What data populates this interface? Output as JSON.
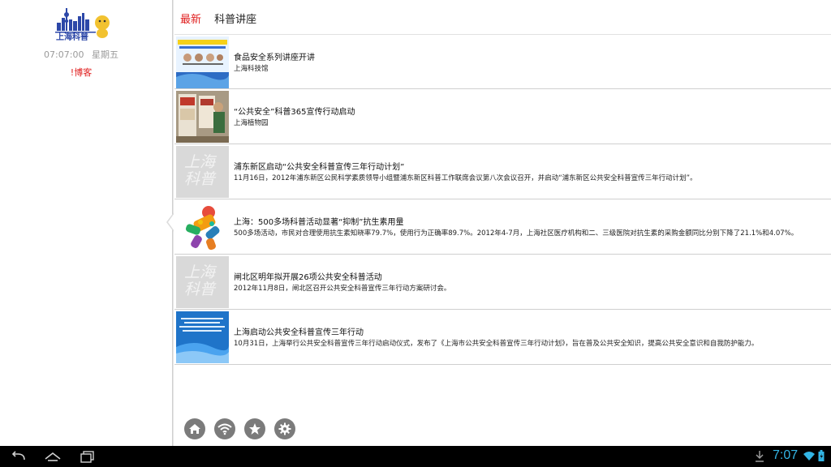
{
  "app": {
    "logo_text": "上海科普"
  },
  "sidebar": {
    "time": "07:07:00",
    "weekday": "星期五",
    "blog_link": "!博客"
  },
  "tabs": [
    {
      "label": "最新",
      "active": true
    },
    {
      "label": "科普讲座",
      "active": false
    }
  ],
  "articles": [
    {
      "title": "食品安全系列讲座开讲",
      "subtitle": "上海科技馆",
      "thumb": "lecture-banner"
    },
    {
      "title": "“公共安全”科普365宣传行动启动",
      "subtitle": "上海植物园",
      "thumb": "exhibition-photo"
    },
    {
      "title": "浦东新区启动“公共安全科普宣传三年行动计划”",
      "subtitle": "11月16日，2012年浦东新区公民科学素质领导小组暨浦东新区科普工作联席会议第八次会议召开，并启动“浦东新区公共安全科普宣传三年行动计划”。",
      "thumb": "placeholder"
    },
    {
      "title": "上海：500多场科普活动显著“抑制”抗生素用量",
      "subtitle": "500多场活动，市民对合理使用抗生素知晓率79.7%，使用行为正确率89.7%。2012年4-7月，上海社区医疗机构和二、三级医院对抗生素的采购金额同比分别下降了21.1%和4.07%。",
      "thumb": "pill-figure"
    },
    {
      "title": "闸北区明年拟开展26项公共安全科普活动",
      "subtitle": "2012年11月8日，闸北区召开公共安全科普宣传三年行动方案研讨会。",
      "thumb": "placeholder"
    },
    {
      "title": "上海启动公共安全科普宣传三年行动",
      "subtitle": "10月31日，上海举行公共安全科普宣传三年行动启动仪式，发布了《上海市公共安全科普宣传三年行动计划》，旨在普及公共安全知识，提高公共安全意识和自我防护能力。",
      "thumb": "blue-slide"
    }
  ],
  "placeholder_text": "上海科普",
  "actions": [
    "home-icon",
    "wifi-icon",
    "star-icon",
    "gear-icon"
  ],
  "system_bar": {
    "time": "7:07"
  },
  "colors": {
    "accent_red": "#e02020",
    "status_blue": "#33b5e5",
    "action_gray": "#7b7b7b"
  }
}
